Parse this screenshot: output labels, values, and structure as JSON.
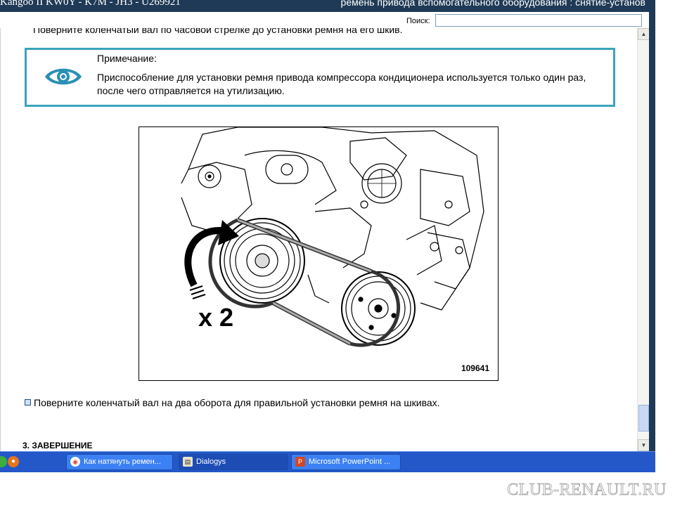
{
  "window": {
    "title_left": "Kangoo II KW0Y - K7M - JH3 - U269921",
    "title_right": "ремень привода вспомогательного оборудования : снятие-установ"
  },
  "search": {
    "label": "Поиск:",
    "value": "",
    "placeholder": ""
  },
  "content": {
    "cutoff_line": "Поверните коленчатый вал по часовой стрелке до установки ремня на его шкив.",
    "note": {
      "icon": "eye-icon",
      "title": "Примечание:",
      "text": "Приспособление для установки ремня привода компрессора кондиционера используется только один раз, после чего отправляется на утилизацию."
    },
    "figure": {
      "multiplier_label": "x 2",
      "figure_number": "109641"
    },
    "step": "Поверните коленчатый вал на два оборота для правильной установки ремня на шкивах.",
    "section_heading": "3. ЗАВЕРШЕНИЕ"
  },
  "taskbar": {
    "tasks": [
      {
        "label": "Как натянуть ремен...",
        "icon": "chrome-icon"
      },
      {
        "label": "Dialogys",
        "icon": "dialogys-icon"
      },
      {
        "label": "Microsoft PowerPoint ...",
        "icon": "powerpoint-icon"
      }
    ]
  },
  "watermark": "CLUB-RENAULT.RU",
  "colors": {
    "note_border": "#3ba3bd",
    "eye": "#2a8fb5",
    "taskbar": "#2458c8",
    "titlebar": "#1f3a56"
  }
}
